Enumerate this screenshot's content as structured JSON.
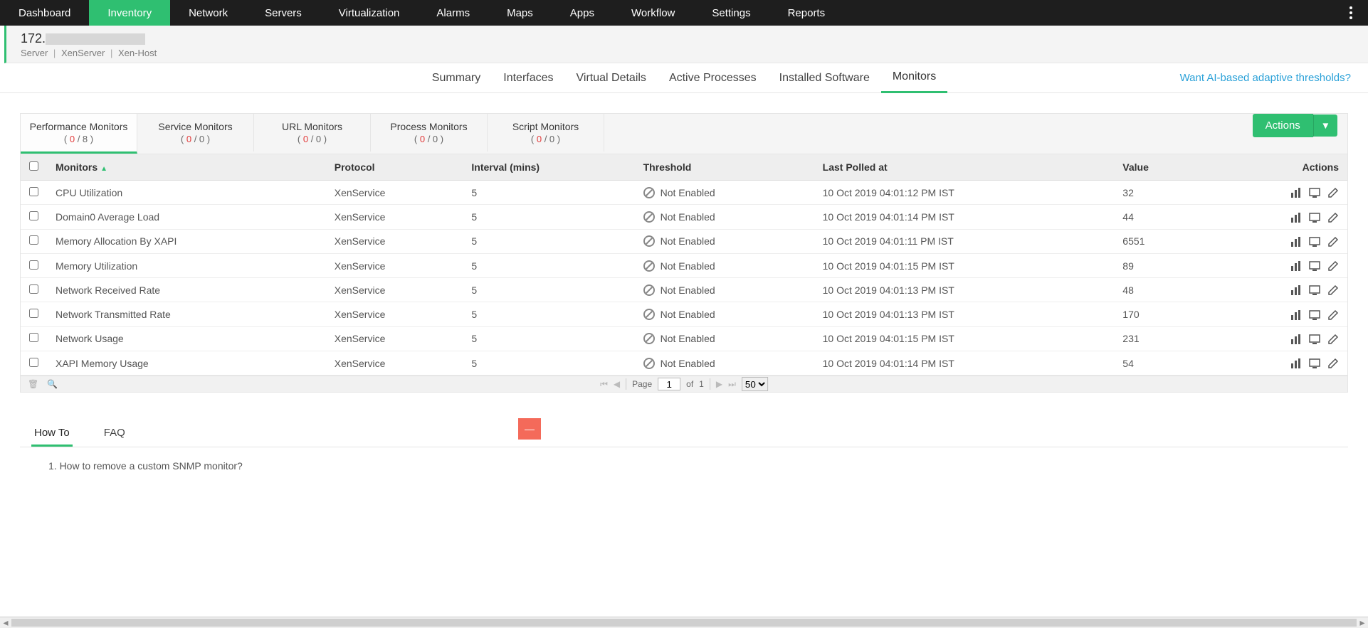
{
  "topnav": {
    "items": [
      "Dashboard",
      "Inventory",
      "Network",
      "Servers",
      "Virtualization",
      "Alarms",
      "Maps",
      "Apps",
      "Workflow",
      "Settings",
      "Reports"
    ],
    "active_index": 1
  },
  "subheader": {
    "title_prefix": "172.",
    "crumbs": [
      "Server",
      "XenServer",
      "Xen-Host"
    ]
  },
  "subnav": {
    "items": [
      "Summary",
      "Interfaces",
      "Virtual Details",
      "Active Processes",
      "Installed Software",
      "Monitors"
    ],
    "active_index": 5,
    "right_link": "Want AI-based adaptive thresholds?"
  },
  "monitor_tabs": [
    {
      "title": "Performance Monitors",
      "cur": "0",
      "total": "8"
    },
    {
      "title": "Service Monitors",
      "cur": "0",
      "total": "0"
    },
    {
      "title": "URL Monitors",
      "cur": "0",
      "total": "0"
    },
    {
      "title": "Process Monitors",
      "cur": "0",
      "total": "0"
    },
    {
      "title": "Script Monitors",
      "cur": "0",
      "total": "0"
    }
  ],
  "monitor_tabs_active": 0,
  "actions_label": "Actions",
  "table": {
    "headers": [
      "Monitors",
      "Protocol",
      "Interval (mins)",
      "Threshold",
      "Last Polled at",
      "Value",
      "Actions"
    ],
    "rows": [
      {
        "monitor": "CPU Utilization",
        "protocol": "XenService",
        "interval": "5",
        "threshold": "Not Enabled",
        "polled": "10 Oct 2019 04:01:12 PM IST",
        "value": "32"
      },
      {
        "monitor": "Domain0 Average Load",
        "protocol": "XenService",
        "interval": "5",
        "threshold": "Not Enabled",
        "polled": "10 Oct 2019 04:01:14 PM IST",
        "value": "44"
      },
      {
        "monitor": "Memory Allocation By XAPI",
        "protocol": "XenService",
        "interval": "5",
        "threshold": "Not Enabled",
        "polled": "10 Oct 2019 04:01:11 PM IST",
        "value": "6551"
      },
      {
        "monitor": "Memory Utilization",
        "protocol": "XenService",
        "interval": "5",
        "threshold": "Not Enabled",
        "polled": "10 Oct 2019 04:01:15 PM IST",
        "value": "89"
      },
      {
        "monitor": "Network Received Rate",
        "protocol": "XenService",
        "interval": "5",
        "threshold": "Not Enabled",
        "polled": "10 Oct 2019 04:01:13 PM IST",
        "value": "48"
      },
      {
        "monitor": "Network Transmitted Rate",
        "protocol": "XenService",
        "interval": "5",
        "threshold": "Not Enabled",
        "polled": "10 Oct 2019 04:01:13 PM IST",
        "value": "170"
      },
      {
        "monitor": "Network Usage",
        "protocol": "XenService",
        "interval": "5",
        "threshold": "Not Enabled",
        "polled": "10 Oct 2019 04:01:15 PM IST",
        "value": "231"
      },
      {
        "monitor": "XAPI Memory Usage",
        "protocol": "XenService",
        "interval": "5",
        "threshold": "Not Enabled",
        "polled": "10 Oct 2019 04:01:14 PM IST",
        "value": "54"
      }
    ]
  },
  "pager": {
    "page_label": "Page",
    "page": "1",
    "of_label": "of",
    "total": "1",
    "page_size": "50"
  },
  "howto": {
    "tabs": [
      "How To",
      "FAQ"
    ],
    "active": 0,
    "items": [
      "1. How to remove a custom SNMP monitor?"
    ]
  }
}
